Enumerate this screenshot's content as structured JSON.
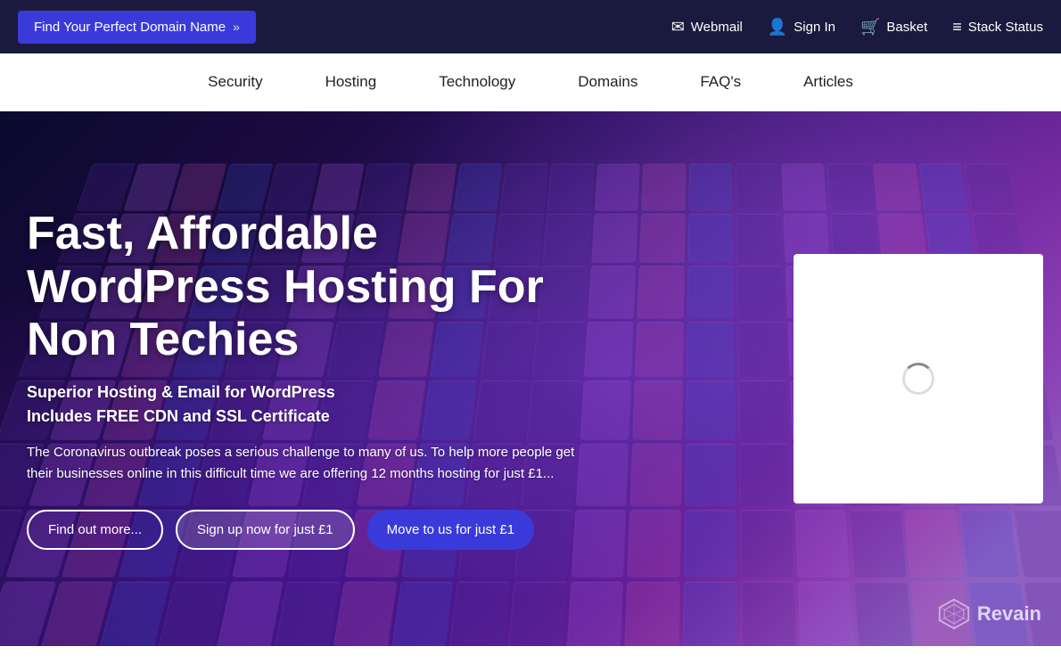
{
  "topbar": {
    "domain_btn_label": "Find Your Perfect Domain Name",
    "domain_btn_chevrons": "»",
    "links": [
      {
        "id": "webmail",
        "label": "Webmail",
        "icon": "✉"
      },
      {
        "id": "signin",
        "label": "Sign In",
        "icon": "👤"
      },
      {
        "id": "basket",
        "label": "Basket",
        "icon": "🛒"
      },
      {
        "id": "stack-status",
        "label": "Stack Status",
        "icon": "≡"
      }
    ]
  },
  "mainnav": {
    "items": [
      {
        "id": "security",
        "label": "Security"
      },
      {
        "id": "hosting",
        "label": "Hosting"
      },
      {
        "id": "technology",
        "label": "Technology"
      },
      {
        "id": "domains",
        "label": "Domains"
      },
      {
        "id": "faqs",
        "label": "FAQ's"
      },
      {
        "id": "articles",
        "label": "Articles"
      }
    ]
  },
  "hero": {
    "title": "Fast, Affordable WordPress Hosting For Non Techies",
    "subtitle1": "Superior Hosting & Email for WordPress",
    "subtitle2": "Includes FREE CDN and SSL Certificate",
    "covid_text": "The Coronavirus outbreak poses a serious challenge to many of us. To help more people get their businesses online in this difficult time we are offering 12 months hosting for just £1...",
    "btn1": "Find out more...",
    "btn2": "Sign up now for just £1",
    "btn3": "Move to us for just £1",
    "revain_label": "Revain"
  }
}
